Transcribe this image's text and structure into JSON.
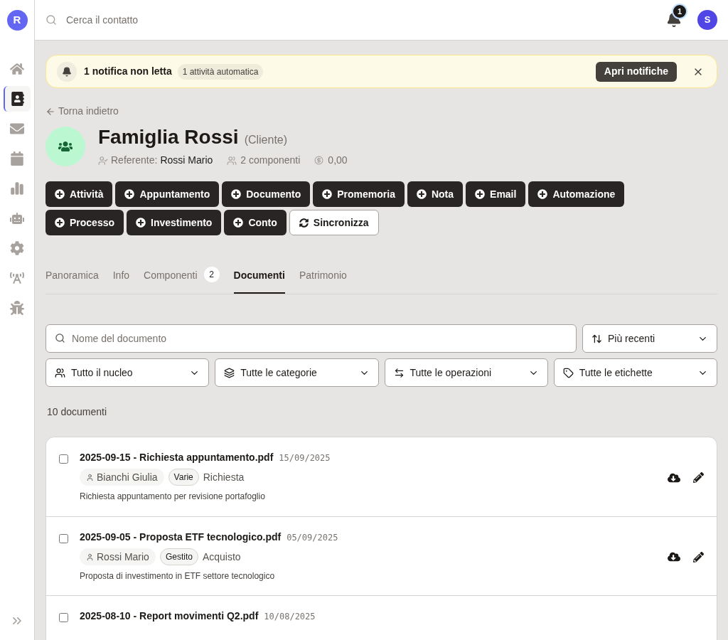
{
  "sidebar": {
    "logo": "R",
    "items": [
      {
        "selected": false
      },
      {
        "selected": true
      },
      {
        "selected": false
      },
      {
        "selected": false
      },
      {
        "selected": false
      },
      {
        "selected": false
      },
      {
        "selected": false
      },
      {
        "selected": false
      },
      {
        "selected": false
      }
    ]
  },
  "header": {
    "search_placeholder": "Cerca il contatto",
    "notification_count": "1",
    "avatar": "S"
  },
  "banner": {
    "title": "1 notifica non letta",
    "badge": "1 attività automatica",
    "button": "Apri notifiche"
  },
  "back_link": "Torna indietro",
  "contact": {
    "name": "Famiglia Rossi",
    "type": "(Cliente)",
    "referent_label": "Referente:",
    "referent": "Rossi Mario",
    "members": "2 componenti",
    "balance": "0,00"
  },
  "actions": [
    {
      "label": "Attività",
      "kind": "add"
    },
    {
      "label": "Appuntamento",
      "kind": "add"
    },
    {
      "label": "Documento",
      "kind": "add"
    },
    {
      "label": "Promemoria",
      "kind": "add"
    },
    {
      "label": "Nota",
      "kind": "add"
    },
    {
      "label": "Email",
      "kind": "add"
    },
    {
      "label": "Automazione",
      "kind": "add"
    },
    {
      "label": "Processo",
      "kind": "add"
    },
    {
      "label": "Investimento",
      "kind": "add"
    },
    {
      "label": "Conto",
      "kind": "add"
    },
    {
      "label": "Sincronizza",
      "kind": "sync"
    }
  ],
  "tabs": [
    {
      "label": "Panoramica",
      "selected": false
    },
    {
      "label": "Info",
      "selected": false
    },
    {
      "label": "Componenti",
      "count": "2",
      "selected": false
    },
    {
      "label": "Documenti",
      "selected": true
    },
    {
      "label": "Patrimonio",
      "selected": false
    }
  ],
  "filters": {
    "search_placeholder": "Nome del documento",
    "sort": "Più recenti",
    "selects": [
      {
        "value": "Tutto il nucleo"
      },
      {
        "value": "Tutte le categorie"
      },
      {
        "value": "Tutte le operazioni"
      },
      {
        "value": "Tutte le etichette"
      }
    ]
  },
  "count": "10 documenti",
  "documents": [
    {
      "title": "2025-09-15 - Richiesta appuntamento.pdf",
      "date": "15/09/2025",
      "owner": "Bianchi Giulia",
      "category": "Varie",
      "operation": "Richiesta",
      "description": "Richiesta appuntamento per revisione portafoglio",
      "checked": false
    },
    {
      "title": "2025-09-05 - Proposta ETF tecnologico.pdf",
      "date": "05/09/2025",
      "owner": "Rossi Mario",
      "category": "Gestito",
      "operation": "Acquisto",
      "description": "Proposta di investimento in ETF settore tecnologico",
      "checked": false
    },
    {
      "title": "2025-08-10 - Report movimenti Q2.pdf",
      "date": "10/08/2025",
      "checked": false
    }
  ]
}
